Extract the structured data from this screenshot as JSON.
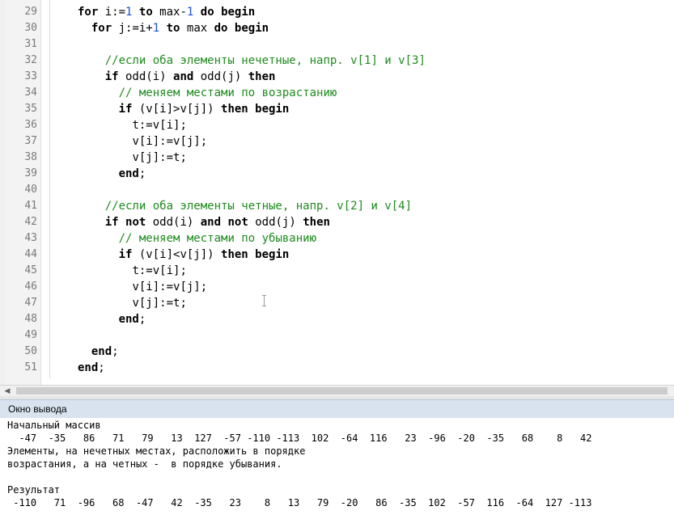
{
  "editor": {
    "lines": [
      {
        "num": "29",
        "indent": "",
        "tokens": [
          [
            "kw",
            "for"
          ],
          [
            "t",
            " i:="
          ],
          [
            "num",
            "1"
          ],
          [
            "t",
            " "
          ],
          [
            "kw",
            "to"
          ],
          [
            "t",
            " max-"
          ],
          [
            "num",
            "1"
          ],
          [
            "t",
            " "
          ],
          [
            "kw",
            "do"
          ],
          [
            "t",
            " "
          ],
          [
            "kw",
            "begin"
          ]
        ]
      },
      {
        "num": "30",
        "indent": "  ",
        "tokens": [
          [
            "kw",
            "for"
          ],
          [
            "t",
            " j:=i+"
          ],
          [
            "num",
            "1"
          ],
          [
            "t",
            " "
          ],
          [
            "kw",
            "to"
          ],
          [
            "t",
            " max "
          ],
          [
            "kw",
            "do"
          ],
          [
            "t",
            " "
          ],
          [
            "kw",
            "begin"
          ]
        ]
      },
      {
        "num": "31",
        "indent": "",
        "tokens": []
      },
      {
        "num": "32",
        "indent": "    ",
        "tokens": [
          [
            "cm",
            "//если оба элементы нечетные, напр. v[1] и v[3]"
          ]
        ]
      },
      {
        "num": "33",
        "indent": "    ",
        "tokens": [
          [
            "kw",
            "if"
          ],
          [
            "t",
            " odd(i) "
          ],
          [
            "kw",
            "and"
          ],
          [
            "t",
            " odd(j) "
          ],
          [
            "kw",
            "then"
          ]
        ]
      },
      {
        "num": "34",
        "indent": "      ",
        "tokens": [
          [
            "cm",
            "// меняем местами по возрастанию"
          ]
        ]
      },
      {
        "num": "35",
        "indent": "      ",
        "tokens": [
          [
            "kw",
            "if"
          ],
          [
            "t",
            " (v[i]>v[j]) "
          ],
          [
            "kw",
            "then"
          ],
          [
            "t",
            " "
          ],
          [
            "kw",
            "begin"
          ]
        ]
      },
      {
        "num": "36",
        "indent": "        ",
        "tokens": [
          [
            "t",
            "t:=v[i];"
          ]
        ]
      },
      {
        "num": "37",
        "indent": "        ",
        "tokens": [
          [
            "t",
            "v[i]:=v[j];"
          ]
        ]
      },
      {
        "num": "38",
        "indent": "        ",
        "tokens": [
          [
            "t",
            "v[j]:=t;"
          ]
        ]
      },
      {
        "num": "39",
        "indent": "      ",
        "tokens": [
          [
            "kw",
            "end"
          ],
          [
            "t",
            ";"
          ]
        ]
      },
      {
        "num": "40",
        "indent": "",
        "tokens": []
      },
      {
        "num": "41",
        "indent": "    ",
        "tokens": [
          [
            "cm",
            "//если оба элементы четные, напр. v[2] и v[4]"
          ]
        ]
      },
      {
        "num": "42",
        "indent": "    ",
        "tokens": [
          [
            "kw",
            "if"
          ],
          [
            "t",
            " "
          ],
          [
            "kw",
            "not"
          ],
          [
            "t",
            " odd(i) "
          ],
          [
            "kw",
            "and"
          ],
          [
            "t",
            " "
          ],
          [
            "kw",
            "not"
          ],
          [
            "t",
            " odd(j) "
          ],
          [
            "kw",
            "then"
          ]
        ]
      },
      {
        "num": "43",
        "indent": "      ",
        "tokens": [
          [
            "cm",
            "// меняем местами по убыванию"
          ]
        ]
      },
      {
        "num": "44",
        "indent": "      ",
        "tokens": [
          [
            "kw",
            "if"
          ],
          [
            "t",
            " (v[i]<v[j]) "
          ],
          [
            "kw",
            "then"
          ],
          [
            "t",
            " "
          ],
          [
            "kw",
            "begin"
          ]
        ]
      },
      {
        "num": "45",
        "indent": "        ",
        "tokens": [
          [
            "t",
            "t:=v[i];"
          ]
        ]
      },
      {
        "num": "46",
        "indent": "        ",
        "tokens": [
          [
            "t",
            "v[i]:=v[j];"
          ]
        ]
      },
      {
        "num": "47",
        "indent": "        ",
        "tokens": [
          [
            "t",
            "v[j]:=t;"
          ]
        ]
      },
      {
        "num": "48",
        "indent": "      ",
        "tokens": [
          [
            "kw",
            "end"
          ],
          [
            "t",
            ";"
          ]
        ]
      },
      {
        "num": "49",
        "indent": "",
        "tokens": []
      },
      {
        "num": "50",
        "indent": "  ",
        "tokens": [
          [
            "kw",
            "end"
          ],
          [
            "t",
            ";"
          ]
        ]
      },
      {
        "num": "51",
        "indent": "",
        "tokens": [
          [
            "kw",
            "end"
          ],
          [
            "t",
            ";"
          ]
        ]
      }
    ]
  },
  "output_panel": {
    "title": "Окно вывода",
    "lines": [
      "Начальный массив",
      "  -47  -35   86   71   79   13  127  -57 -110 -113  102  -64  116   23  -96  -20  -35   68    8   42",
      "Элементы, на нечетных местах, расположить в порядке",
      "возрастания, а на четных -  в порядке убывания.",
      "",
      "Результат",
      " -110   71  -96   68  -47   42  -35   23    8   13   79  -20   86  -35  102  -57  116  -64  127 -113"
    ]
  },
  "colors": {
    "keyword": "#000000",
    "number": "#1a4fd6",
    "comment": "#1e8a1e",
    "line_number": "#7a7a7a",
    "output_header_bg": "#d9e3f0"
  },
  "icons": {
    "scroll_left": "arrow-left-icon",
    "scroll_right": "arrow-right-icon",
    "text_cursor": "i-beam-cursor-icon"
  }
}
